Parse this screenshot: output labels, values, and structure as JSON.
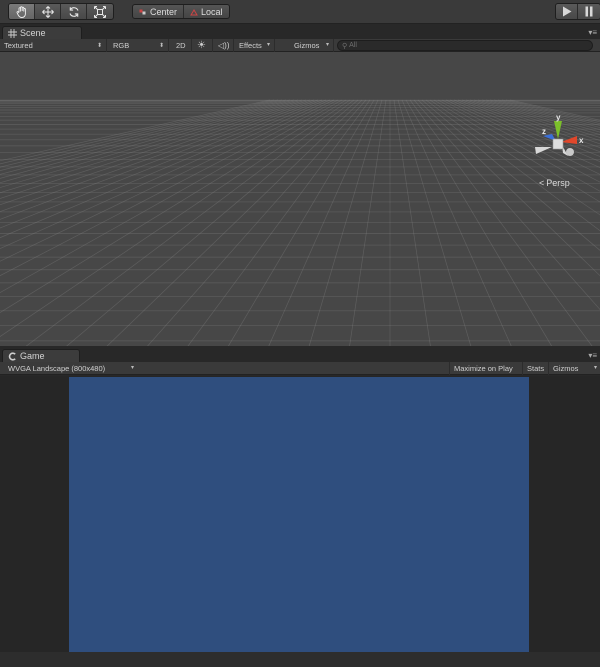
{
  "toolbar": {
    "tools": [
      "hand-icon",
      "move-icon",
      "rotate-icon",
      "scale-icon"
    ],
    "pivot_center": "Center",
    "pivot_local": "Local"
  },
  "scene": {
    "tab_label": "Scene",
    "draw_mode": "Textured",
    "render_mode": "RGB",
    "mode_2d": "2D",
    "effects": "Effects",
    "gizmos": "Gizmos",
    "search_placeholder": "All",
    "projection": "Persp",
    "gizmo_axes": {
      "y": "y",
      "x": "x",
      "z": "z"
    }
  },
  "game": {
    "tab_label": "Game",
    "aspect": "WVGA Landscape (800x480)",
    "maximize_on_play": "Maximize on Play",
    "stats": "Stats",
    "gizmos": "Gizmos"
  },
  "colors": {
    "game_background": "#2f4e7e",
    "scene_background": "#474747",
    "axis_y": "#7cc02a",
    "axis_x": "#e0472b",
    "axis_z": "#3a6fd8"
  }
}
